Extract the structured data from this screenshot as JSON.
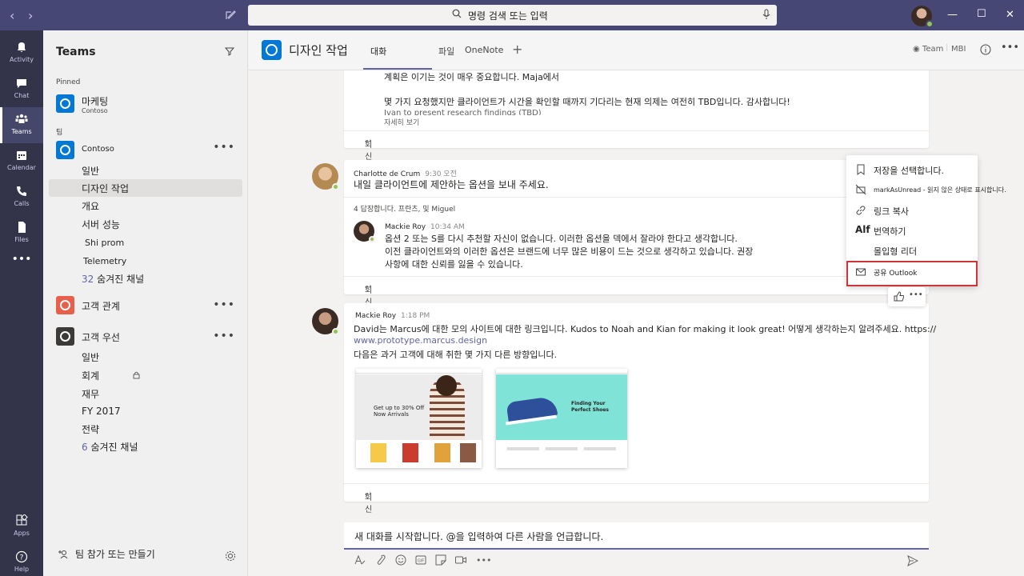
{
  "search": {
    "placeholder": "명령 검색 또는 입력"
  },
  "rail": [
    {
      "label": "Activity"
    },
    {
      "label": "Chat"
    },
    {
      "label": "Teams"
    },
    {
      "label": "Calendar"
    },
    {
      "label": "Calls"
    },
    {
      "label": "Files"
    },
    {
      "label": "Apps"
    },
    {
      "label": "Help"
    }
  ],
  "left": {
    "title": "Teams",
    "pinned_label": "Pinned",
    "team_label": "팀",
    "pinned_team": {
      "name": "마케팅",
      "sub": "Contoso"
    },
    "contoso": {
      "name": "Contoso",
      "channels": [
        "일반",
        "디자인 작업",
        "개요",
        "서버 성능",
        "Shi prom",
        "Telemetry"
      ],
      "hidden_count": "32",
      "hidden_label": "숨겨진 채널"
    },
    "customer_relations": {
      "name": "고객 관계"
    },
    "customer_first": {
      "name": "고객 우선",
      "channels": [
        "일반",
        "회계",
        "재무",
        "FY 2017",
        "전략"
      ],
      "hidden_count": "6",
      "hidden_label": "숨겨진 채널"
    },
    "bottom": "팀 참가 또는 만들기"
  },
  "header": {
    "channel": "디자인 작업",
    "tabs": [
      "대화",
      "파일",
      "OneNote"
    ],
    "team_btn": "Team",
    "mbi": "MBI"
  },
  "messages": {
    "m0": {
      "line1": "계획은 이기는 것이 매우 중요합니다. Maja에서",
      "line2": "몇 가지 요청했지만 클라이언트가 시간을 확인할 때까지 기다리는 현재 의제는 여전히 TBD입니다. 감사합니다!",
      "line3": "Ivan to present research findings (TBD)",
      "see_more": "자세히 보기",
      "reply": "회신"
    },
    "m1": {
      "author": "Charlotte de Crum",
      "time": "9:30 오전",
      "text": "내일 클라이언트에 제안하는 옵션을 보내 주세요.",
      "replies": "4 답장합니다. 프란츠, 및 Miguel",
      "sub_author": "Mackie Roy",
      "sub_time": "10:34 AM",
      "sub_l1": "옵션 2 또는 S를 다시 추천할 자신이 없습니다. 이러한 옵션을 덱에서 잘라야 한다고 생각합니다.",
      "sub_l2": "이전 클라이언트와의 이러한 옵션은 브랜드에 너무 많은 비용이 드는 것으로 생각하고 있습니다. 권장",
      "sub_l3": "사항에 대한 신뢰를 잃을 수 있습니다.",
      "reply": "회신"
    },
    "m2": {
      "author": "Mackie Roy",
      "time": "1:18 PM",
      "l1": "David는 Marcus에 대한 모의 사이트에 대한 링크입니다. Kudos to Noah and Kian for making it look great! 어떻게 생각하는지 알려주세요. https://",
      "link": "www.prototype.marcus.design",
      "l2": "다음은 과거 고객에 대해 취한 몇 가지 다른 방향입니다.",
      "thumb1": {
        "headline": "Get up to 30% Off",
        "sub": "Now Arrivals"
      },
      "thumb2": {
        "headline": "Finding Your",
        "sub": "Perfect Shoes"
      },
      "reply": "회신"
    }
  },
  "menu": {
    "items": [
      {
        "label": "저장을 선택합니다.",
        "icon": "bookmark-icon"
      },
      {
        "label": "markAsUnread - 읽지 않은 상태로 표시합니다.",
        "icon": "unread-icon"
      },
      {
        "label": "링크 복사",
        "icon": "link-icon"
      },
      {
        "label": "번역하기",
        "icon": "translate-icon"
      },
      {
        "label": "몰입형 리더",
        "icon": "immersive-reader-icon"
      },
      {
        "label": "공유 Outlook",
        "icon": "mail-icon"
      }
    ],
    "translate_glyph": "Alf"
  },
  "compose": {
    "placeholder": "새 대화를 시작합니다. @을 입력하여 다른 사람을 언급합니다."
  },
  "colors": {
    "accent": "#6264a7",
    "titlebar": "#464775",
    "rail": "#33344a",
    "highlight": "#d13438"
  }
}
